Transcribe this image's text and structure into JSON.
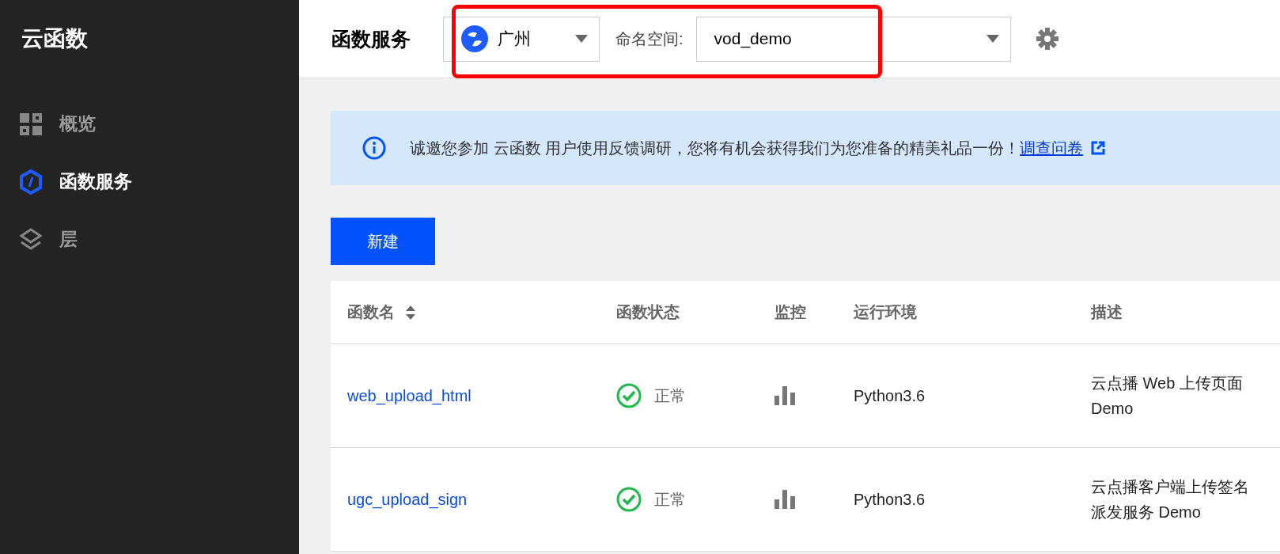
{
  "sidebar": {
    "title": "云函数",
    "items": [
      {
        "label": "概览",
        "kind": "overview",
        "selected": false
      },
      {
        "label": "函数服务",
        "kind": "functions",
        "selected": true
      },
      {
        "label": "层",
        "kind": "layers",
        "selected": false
      }
    ]
  },
  "header": {
    "title": "函数服务",
    "region": "广州",
    "namespace_label": "命名空间:",
    "namespace": "vod_demo"
  },
  "banner": {
    "text": "诚邀您参加 云函数 用户使用反馈调研，您将有机会获得我们为您准备的精美礼品一份！",
    "link": "调查问卷"
  },
  "create_button": "新建",
  "table": {
    "columns": [
      {
        "label": "函数名",
        "sortable": true
      },
      {
        "label": "函数状态",
        "sortable": false
      },
      {
        "label": "监控",
        "sortable": false
      },
      {
        "label": "运行环境",
        "sortable": false
      },
      {
        "label": "描述",
        "sortable": false
      }
    ],
    "rows": [
      {
        "name": "web_upload_html",
        "status": "正常",
        "runtime": "Python3.6",
        "description": "云点播 Web 上传页面 Demo"
      },
      {
        "name": "ugc_upload_sign",
        "status": "正常",
        "runtime": "Python3.6",
        "description": "云点播客户端上传签名派发服务 Demo"
      }
    ]
  }
}
